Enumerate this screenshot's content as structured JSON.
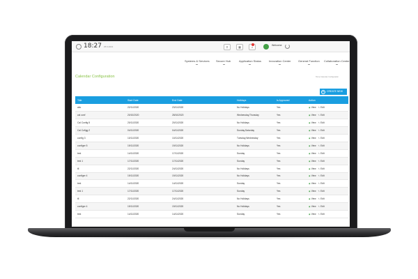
{
  "topbar": {
    "time": "18:27",
    "date": "25.6.2021",
    "search_icon": "search-icon",
    "grid_icon": "grid-icon",
    "bell_icon": "bell-icon",
    "welcome": "Welcome"
  },
  "menu": {
    "items": [
      {
        "label": "Systems & Services"
      },
      {
        "label": "Secure Hub"
      },
      {
        "label": "Application Status"
      },
      {
        "label": "Innovation Center"
      },
      {
        "label": "General Function"
      },
      {
        "label": "Collaboration Center"
      }
    ]
  },
  "page": {
    "title": "Calendar Configuration",
    "breadcrumb": "Home   Calendar Configuration",
    "create_label": "CREATE NEW"
  },
  "table": {
    "headers": [
      "Title",
      "Start Date",
      "End Date",
      "Holidays",
      "Is Approved",
      "Action"
    ],
    "view_label": "View",
    "edit_label": "Edit",
    "rows": [
      [
        "abc",
        "22/11/2020",
        "23/11/2020",
        "No Holidays",
        "Yes"
      ],
      [
        "cal conf",
        "20/10/2020",
        "28/10/2020",
        "Wednesday,Thursday",
        "Yes"
      ],
      [
        "Cal Config 5",
        "20/11/2020",
        "20/11/2020",
        "No Holidays",
        "Yes"
      ],
      [
        "Cal Cofigg 2",
        "04/11/2020",
        "04/11/2020",
        "Sunday,Saturday",
        "Yes"
      ],
      [
        "config 3",
        "10/11/2020",
        "10/11/2020",
        "Tuesday,Wednesday",
        "Yes"
      ],
      [
        "configer 5",
        "19/11/2020",
        "19/11/2020",
        "No Holidays",
        "Yes"
      ],
      [
        "test",
        "14/11/2020",
        "17/11/2020",
        "Sunday",
        "Yes"
      ],
      [
        "test 1",
        "17/11/2020",
        "17/11/2020",
        "Sunday",
        "Yes"
      ],
      [
        "tll",
        "22/11/2020",
        "24/11/2020",
        "No Holidays",
        "Yes"
      ],
      [
        "configer 4",
        "19/11/2020",
        "19/11/2020",
        "No Holidays",
        "Yes"
      ],
      [
        "test",
        "14/11/2020",
        "14/11/2020",
        "Sunday",
        "Yes"
      ],
      [
        "test 1",
        "17/11/2020",
        "17/11/2020",
        "Sunday",
        "Yes"
      ],
      [
        "tll",
        "22/11/2020",
        "24/11/2020",
        "No Holidays",
        "Yes"
      ],
      [
        "configer 4",
        "19/11/2020",
        "19/11/2020",
        "No Holidays",
        "Yes"
      ],
      [
        "test",
        "14/11/2020",
        "14/11/2020",
        "Sunday",
        "Yes"
      ]
    ]
  },
  "colors": {
    "accent": "#1a9ee0",
    "title_green": "#8bc34a",
    "frame": "#1b1b1d"
  }
}
